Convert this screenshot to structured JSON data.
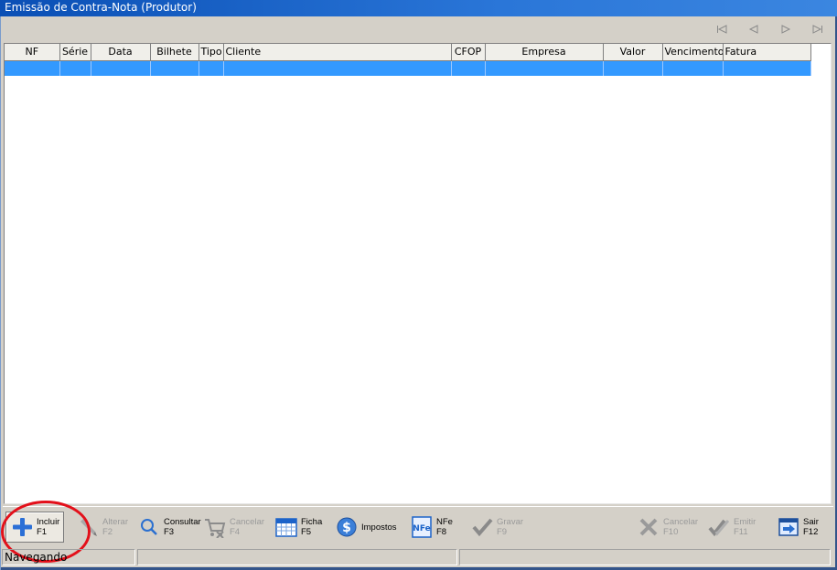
{
  "window": {
    "title": "Emissão de Contra-Nota (Produtor)"
  },
  "navigator": {
    "icons": [
      "first-record-icon",
      "prior-record-icon",
      "next-record-icon",
      "last-record-icon"
    ]
  },
  "grid": {
    "columns": [
      "NF",
      "Série",
      "Data",
      "Bilhete",
      "Tipo",
      "Cliente",
      "CFOP",
      "Empresa",
      "Valor",
      "Vencimento",
      "Fatura"
    ],
    "selected_row_color": "#3399ff"
  },
  "toolbar": {
    "incluir": {
      "label": "Incluir",
      "key": "F1"
    },
    "alterar": {
      "label": "Alterar",
      "key": "F2"
    },
    "consultar": {
      "label": "Consultar",
      "key": "F3"
    },
    "cancelar": {
      "label": "Cancelar",
      "key": "F4"
    },
    "ficha": {
      "label": "Ficha",
      "key": "F5"
    },
    "impostos": {
      "label": "Impostos"
    },
    "nfe": {
      "label": "NFe",
      "key": "F8"
    },
    "gravar": {
      "label": "Gravar",
      "key": "F9"
    },
    "cancelar2": {
      "label": "Cancelar",
      "key": "F10"
    },
    "emitir": {
      "label": "Emitir",
      "key": "F11"
    },
    "sair": {
      "label": "Sair",
      "key": "F12"
    }
  },
  "status": {
    "mode": "Navegando"
  },
  "colors": {
    "title_bar": "#0a4fb5",
    "highlight_circle": "#e3101a",
    "selection": "#3399ff"
  }
}
